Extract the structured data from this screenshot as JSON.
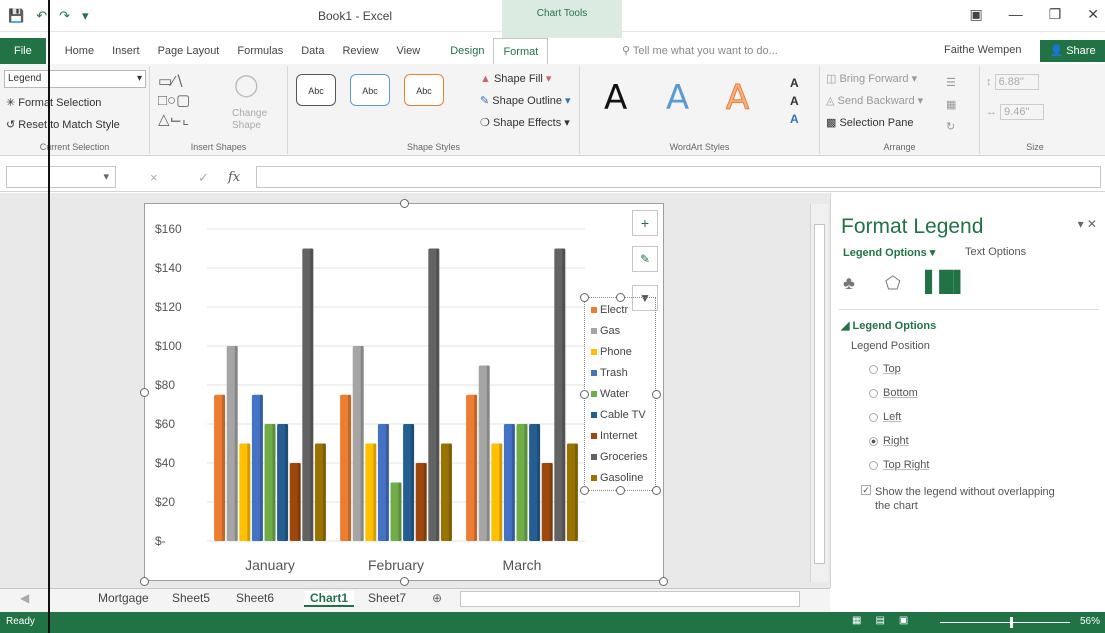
{
  "window": {
    "title": "Book1 - Excel",
    "context_tab": "Chart Tools",
    "user": "Faithe Wempen",
    "share_label": "Share"
  },
  "tabs": [
    {
      "label": "File"
    },
    {
      "label": "Home"
    },
    {
      "label": "Insert"
    },
    {
      "label": "Page Layout"
    },
    {
      "label": "Formulas"
    },
    {
      "label": "Data"
    },
    {
      "label": "Review"
    },
    {
      "label": "View"
    },
    {
      "label": "Design"
    },
    {
      "label": "Format"
    }
  ],
  "tell_me": "Tell me what you want to do...",
  "ribbon": {
    "current_selection": {
      "value": "Legend",
      "format_selection": "Format Selection",
      "reset": "Reset to Match Style",
      "label": "Current Selection"
    },
    "insert_shapes": {
      "change_shape": "Change Shape",
      "label": "Insert Shapes"
    },
    "shape_styles": {
      "sample": "Abc",
      "fill": "Shape Fill",
      "outline": "Shape Outline",
      "effects": "Shape Effects",
      "label": "Shape Styles"
    },
    "wordart": {
      "letter": "A",
      "label": "WordArt Styles"
    },
    "arrange": {
      "bring_forward": "Bring Forward",
      "send_backward": "Send Backward",
      "selection_pane": "Selection Pane",
      "label": "Arrange"
    },
    "size": {
      "height": "6.88\"",
      "width": "9.46\"",
      "label": "Size"
    }
  },
  "formula_bar": {
    "fx": "fx",
    "cancel": "×",
    "enter": "✓"
  },
  "chart_data": {
    "type": "bar",
    "categories": [
      "January",
      "February",
      "March"
    ],
    "y_ticks": [
      "$160",
      "$140",
      "$120",
      "$100",
      "$80",
      "$60",
      "$40",
      "$20",
      "$-"
    ],
    "ylim": [
      0,
      160
    ],
    "series": [
      {
        "name": "Electric",
        "color": "#ed7d31",
        "values": [
          75,
          75,
          75
        ]
      },
      {
        "name": "Gas",
        "color": "#a5a5a5",
        "values": [
          100,
          100,
          90
        ]
      },
      {
        "name": "Phone",
        "color": "#ffc000",
        "values": [
          50,
          50,
          50
        ]
      },
      {
        "name": "Trash",
        "color": "#4472c4",
        "values": [
          75,
          60,
          60
        ]
      },
      {
        "name": "Water",
        "color": "#70ad47",
        "values": [
          60,
          30,
          60
        ]
      },
      {
        "name": "Cable TV",
        "color": "#255e91",
        "values": [
          60,
          60,
          60
        ]
      },
      {
        "name": "Internet",
        "color": "#9e480e",
        "values": [
          40,
          40,
          40
        ]
      },
      {
        "name": "Groceries",
        "color": "#636363",
        "values": [
          150,
          150,
          150
        ]
      },
      {
        "name": "Gasoline",
        "color": "#997300",
        "values": [
          50,
          50,
          50
        ]
      }
    ],
    "legend_labels": [
      "Electr",
      "Gas",
      "Phone",
      "Trash",
      "Water",
      "Cable TV",
      "Internet",
      "Groceries",
      "Gasoline"
    ],
    "legend_position": "right"
  },
  "pane": {
    "title": "Format Legend",
    "tab_legend": "Legend Options",
    "tab_text": "Text Options",
    "section": "Legend Options",
    "position_label": "Legend Position",
    "options": [
      {
        "label": "Top",
        "selected": false
      },
      {
        "label": "Bottom",
        "selected": false
      },
      {
        "label": "Left",
        "selected": false
      },
      {
        "label": "Right",
        "selected": true
      },
      {
        "label": "Top Right",
        "selected": false
      }
    ],
    "checkbox": "Show the legend without overlapping the chart"
  },
  "sheets": [
    "Mortgage",
    "Sheet5",
    "Sheet6",
    "Chart1",
    "Sheet7"
  ],
  "active_sheet": "Chart1",
  "status": {
    "text": "Ready",
    "zoom": "56%"
  }
}
